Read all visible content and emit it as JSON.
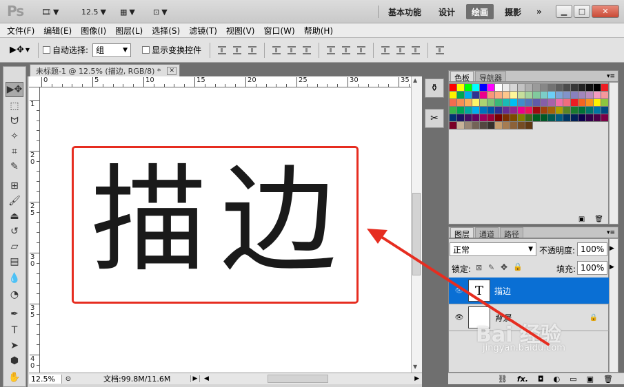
{
  "app": {
    "logo": "Ps",
    "zoom_select": "12.5",
    "workspaces": [
      "基本功能",
      "设计",
      "绘画",
      "摄影"
    ],
    "active_workspace": "绘画",
    "more": "»",
    "win_min": "▁",
    "win_max": "□",
    "win_close": "✕"
  },
  "menu": [
    "文件(F)",
    "编辑(E)",
    "图像(I)",
    "图层(L)",
    "选择(S)",
    "滤镜(T)",
    "视图(V)",
    "窗口(W)",
    "帮助(H)"
  ],
  "options": {
    "auto_select_label": "自动选择:",
    "auto_select_value": "组",
    "show_transform_label": "显示变换控件"
  },
  "document": {
    "tab_title": "未标题-1 @ 12.5% (描边, RGB/8) *",
    "tab_close": "✕",
    "canvas_text": "描边",
    "ruler_h": [
      "0",
      "5",
      "10",
      "15",
      "20",
      "25",
      "30",
      "35"
    ],
    "ruler_v": [
      "1",
      "2\n0",
      "2\n5",
      "3\n0",
      "3\n5",
      "4\n0"
    ],
    "status_zoom": "12.5%",
    "status_doc": "文档:99.8M/11.6M"
  },
  "panels": {
    "swatch_tabs": [
      "色板",
      "导航器"
    ],
    "layer_tabs": [
      "图层",
      "通道",
      "路径"
    ],
    "blend_mode": "正常",
    "opacity_label": "不透明度:",
    "opacity_value": "100%",
    "lock_label": "锁定:",
    "fill_label": "填充:",
    "fill_value": "100%",
    "layers": [
      {
        "name": "描边",
        "thumb": "T",
        "selected": true
      },
      {
        "name": "背景",
        "thumb": "",
        "selected": false
      }
    ],
    "footer_fx": "fx."
  },
  "watermark": {
    "brand": "Bai 经验",
    "url": "jingyan.baidu.com"
  },
  "colors": {
    "accent": "#0a6fd4",
    "annotation_red": "#e62d20",
    "swatches": [
      [
        "#ff0000",
        "#ffff00",
        "#00ff00",
        "#00ffff",
        "#0000ff",
        "#ff00ff",
        "#ffffff",
        "#ebebeb",
        "#d7d7d7",
        "#c3c3c3",
        "#afafaf",
        "#9b9b9b",
        "#878787",
        "#737373",
        "#5f5f5f",
        "#4b4b4b",
        "#373737",
        "#232323",
        "#0f0f0f",
        "#000000"
      ],
      [
        "#ee1d24",
        "#fff200",
        "#00a650",
        "#00aeef",
        "#2e3192",
        "#ec008c",
        "#f7977a",
        "#fbad82",
        "#fdc68c",
        "#fff799",
        "#c6df9c",
        "#a4d49d",
        "#81ca9d",
        "#7bcdc8",
        "#6ccff7",
        "#7ca6d8",
        "#8293ca",
        "#8881be",
        "#a286bd",
        "#bc8cbf"
      ],
      [
        "#f49bc1",
        "#f5989d",
        "#f26c4f",
        "#f68e55",
        "#fbaf5a",
        "#fff467",
        "#acd372",
        "#7cc576",
        "#3bb878",
        "#1abbb4",
        "#00bff3",
        "#438cca",
        "#5574b9",
        "#605ca9",
        "#855fa8",
        "#a763a9",
        "#ef6ea8",
        "#f16d7e",
        "#ed1c24",
        "#f26522"
      ],
      [
        "#f7941d",
        "#fff200",
        "#8dc63f",
        "#39b54a",
        "#00a651",
        "#00a99d",
        "#00aeef",
        "#0072bc",
        "#0054a5",
        "#2e3192",
        "#662d91",
        "#92278f",
        "#ec008c",
        "#ed145a",
        "#9e0b0f",
        "#a0410d",
        "#a36209",
        "#aba000",
        "#598527",
        "#1a7b30"
      ],
      [
        "#007236",
        "#00746b",
        "#0076a4",
        "#004a80",
        "#003471",
        "#1b1464",
        "#440e62",
        "#630460",
        "#9e005d",
        "#9e0039",
        "#790000",
        "#7b2e00",
        "#7d4900",
        "#827b00",
        "#406618",
        "#005e20",
        "#005826",
        "#005952",
        "#005b7f",
        "#003663"
      ],
      [
        "#002157",
        "#0d004c",
        "#32004b",
        "#4b0049",
        "#7b0046",
        "#7a0026",
        "#c7b299",
        "#998675",
        "#736357",
        "#534741",
        "#37302c",
        "#c69c6d",
        "#a67c52",
        "#8c6239",
        "#754c24",
        "#603913"
      ]
    ]
  }
}
